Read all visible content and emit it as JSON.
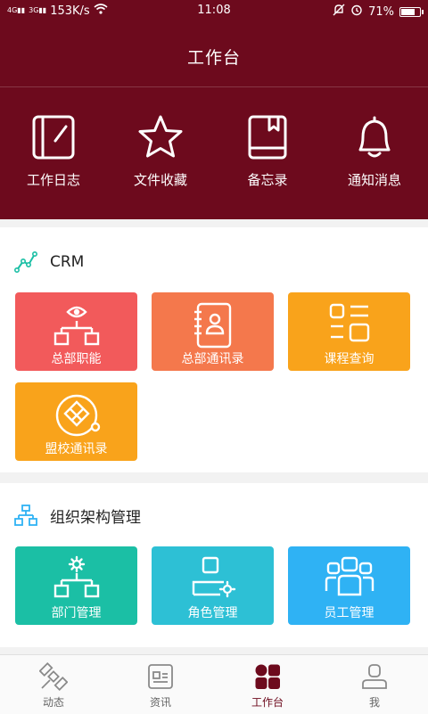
{
  "status": {
    "net_speed": "153K/s",
    "signal_tag_1": "4G",
    "signal_tag_2": "3G",
    "time": "11:08",
    "battery": "71%"
  },
  "header": {
    "title": "工作台",
    "quick_actions": [
      {
        "label": "工作日志",
        "icon": "journal-icon"
      },
      {
        "label": "文件收藏",
        "icon": "star-icon"
      },
      {
        "label": "备忘录",
        "icon": "memo-book-icon"
      },
      {
        "label": "通知消息",
        "icon": "bell-icon"
      }
    ]
  },
  "crm": {
    "title": "CRM",
    "tiles": [
      {
        "label": "总部职能",
        "color": "#f25a5b",
        "icon": "org-eye-icon"
      },
      {
        "label": "总部通讯录",
        "color": "#f4784c",
        "icon": "contact-book-icon"
      },
      {
        "label": "课程查询",
        "color": "#f9a31b",
        "icon": "course-list-icon"
      },
      {
        "label": "盟校通讯录",
        "color": "#f9a31b",
        "icon": "alliance-badge-icon"
      }
    ]
  },
  "org": {
    "title": "组织架构管理",
    "tiles": [
      {
        "label": "部门管理",
        "color": "#1bbfa5",
        "icon": "department-icon"
      },
      {
        "label": "角色管理",
        "color": "#2dc0d5",
        "icon": "role-settings-icon"
      },
      {
        "label": "员工管理",
        "color": "#2fb2f4",
        "icon": "staff-group-icon"
      }
    ]
  },
  "tabbar": {
    "items": [
      {
        "label": "动态",
        "icon": "satellite-icon"
      },
      {
        "label": "资讯",
        "icon": "news-icon"
      },
      {
        "label": "工作台",
        "icon": "workbench-grid-icon"
      },
      {
        "label": "我",
        "icon": "person-icon"
      }
    ],
    "active_index": 2
  },
  "colors": {
    "brand": "#6d0a1d"
  }
}
